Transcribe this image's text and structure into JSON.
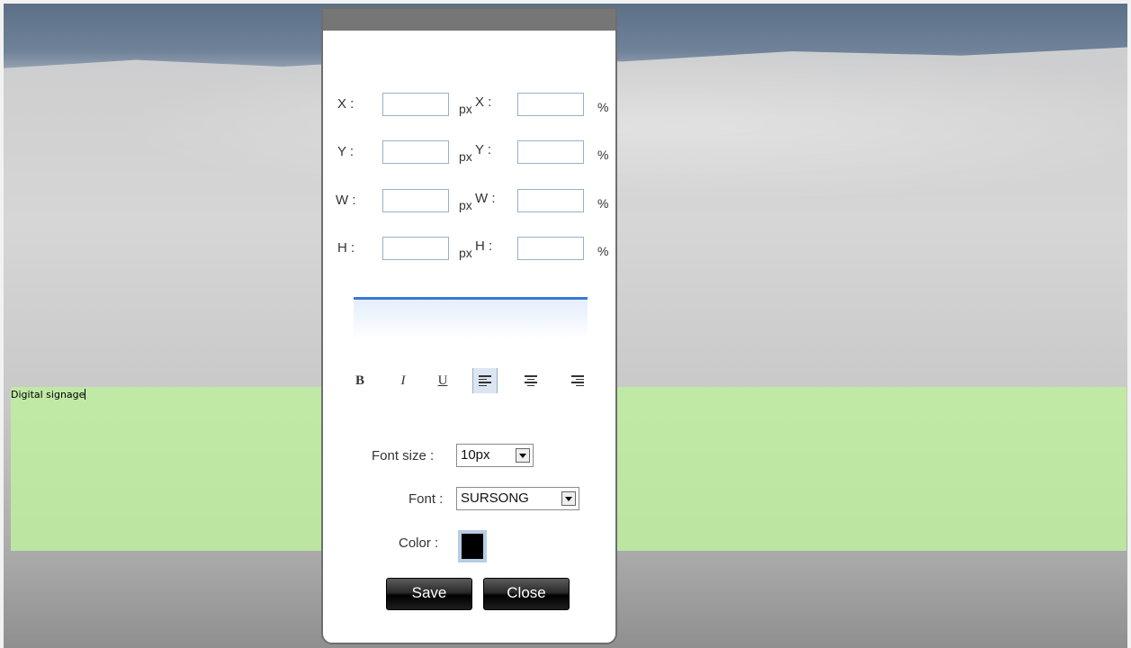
{
  "text_region": {
    "content": "Digital signage",
    "color": "#beeea0"
  },
  "dialog": {
    "position_rows": [
      {
        "label_px": "X :",
        "unit_px": "px",
        "label_pct": "X :",
        "unit_pct": "%",
        "value_px": "",
        "value_pct": ""
      },
      {
        "label_px": "Y :",
        "unit_px": "px",
        "label_pct": "Y :",
        "unit_pct": "%",
        "value_px": "",
        "value_pct": ""
      },
      {
        "label_px": "W :",
        "unit_px": "px",
        "label_pct": "W :",
        "unit_pct": "%",
        "value_px": "",
        "value_pct": ""
      },
      {
        "label_px": "H :",
        "unit_px": "px",
        "label_pct": "H :",
        "unit_pct": "%",
        "value_px": "",
        "value_pct": ""
      }
    ],
    "format": {
      "bold": "B",
      "italic": "I",
      "underline": "U",
      "active_align": "left"
    },
    "font_size": {
      "label": "Font size :",
      "value": "10px"
    },
    "font": {
      "label": "Font :",
      "value": "SURSONG"
    },
    "color": {
      "label": "Color :",
      "value": "#000000"
    },
    "buttons": {
      "save": "Save",
      "close": "Close"
    },
    "accent": "#3a79d4"
  }
}
